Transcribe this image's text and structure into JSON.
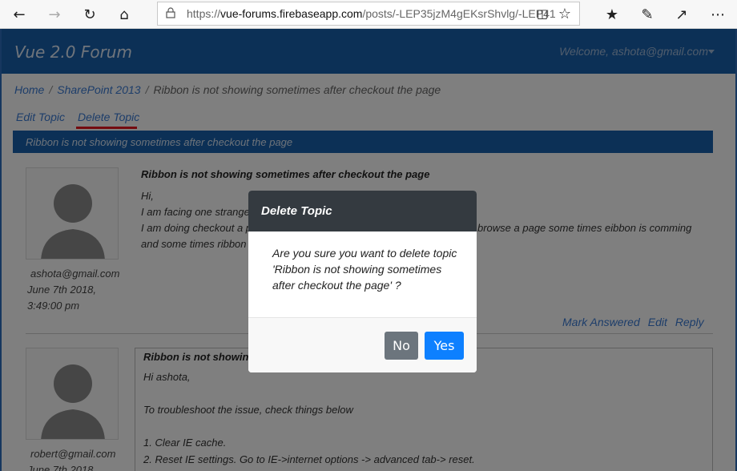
{
  "browser": {
    "url_prefix": "https://",
    "url_host": "vue-forums.firebaseapp.com",
    "url_path": "/posts/-LEP35jzM4gEKsrShvlg/-LEP41"
  },
  "header": {
    "brand": "Vue 2.0 Forum",
    "welcome": "Welcome, ashota@gmail.com"
  },
  "breadcrumb": [
    "Home",
    "SharePoint 2013",
    "Ribbon is not showing sometimes after checkout the page"
  ],
  "topic_actions": {
    "edit": "Edit Topic",
    "delete": "Delete Topic"
  },
  "topic_banner": "Ribbon is not showing sometimes after checkout the page",
  "posts": [
    {
      "author": "ashota@gmail.com",
      "date": "June 7th 2018,",
      "time": "3:49:00 pm",
      "title": "Ribbon is not showing sometimes after checkout the page",
      "body": [
        "Hi,",
        "I am facing one strange",
        "I am doing checkout a p",
        "and some times ribbon i"
      ],
      "body_right": "browse a page some times eibbon is comming",
      "links": [
        "Mark Answered",
        "Edit",
        "Reply"
      ]
    },
    {
      "author": "robert@gmail.com",
      "date": "June 7th 2018",
      "title": "Ribbon is not showing",
      "body": [
        "Hi ashota,",
        "",
        "To troubleshoot the issue, check things below",
        "",
        "1. Clear IE cache.",
        "2. Reset IE settings. Go to IE->internet options -> advanced tab-> reset."
      ]
    }
  ],
  "modal": {
    "title": "Delete Topic",
    "message_line1": "Are you sure you want to delete topic",
    "message_line2": "'Ribbon is not showing sometimes",
    "message_line3": "after checkout the page' ?",
    "no_label": "No",
    "yes_label": "Yes"
  }
}
